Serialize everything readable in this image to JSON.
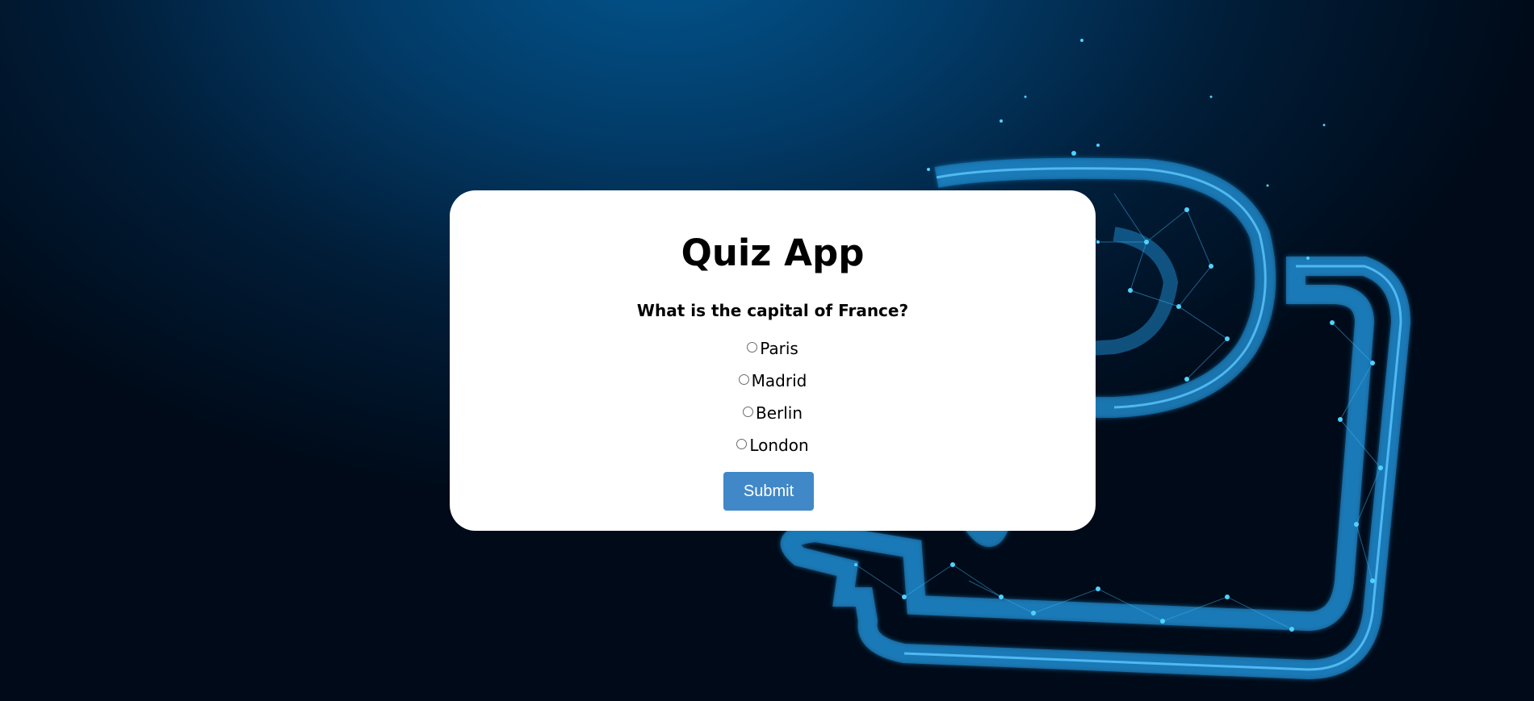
{
  "app": {
    "title": "Quiz App"
  },
  "quiz": {
    "question": "What is the capital of France?",
    "options": [
      {
        "label": "Paris",
        "selected": false
      },
      {
        "label": "Madrid",
        "selected": false
      },
      {
        "label": "Berlin",
        "selected": false
      },
      {
        "label": "London",
        "selected": false
      }
    ],
    "submit_label": "Submit"
  },
  "colors": {
    "accent": "#4088c8",
    "background": "#01213f",
    "card": "#ffffff",
    "network_line": "#1f8fd6",
    "network_node": "#4fd2ff"
  },
  "background_art": {
    "icon": "chat-bubbles-network-icon"
  }
}
